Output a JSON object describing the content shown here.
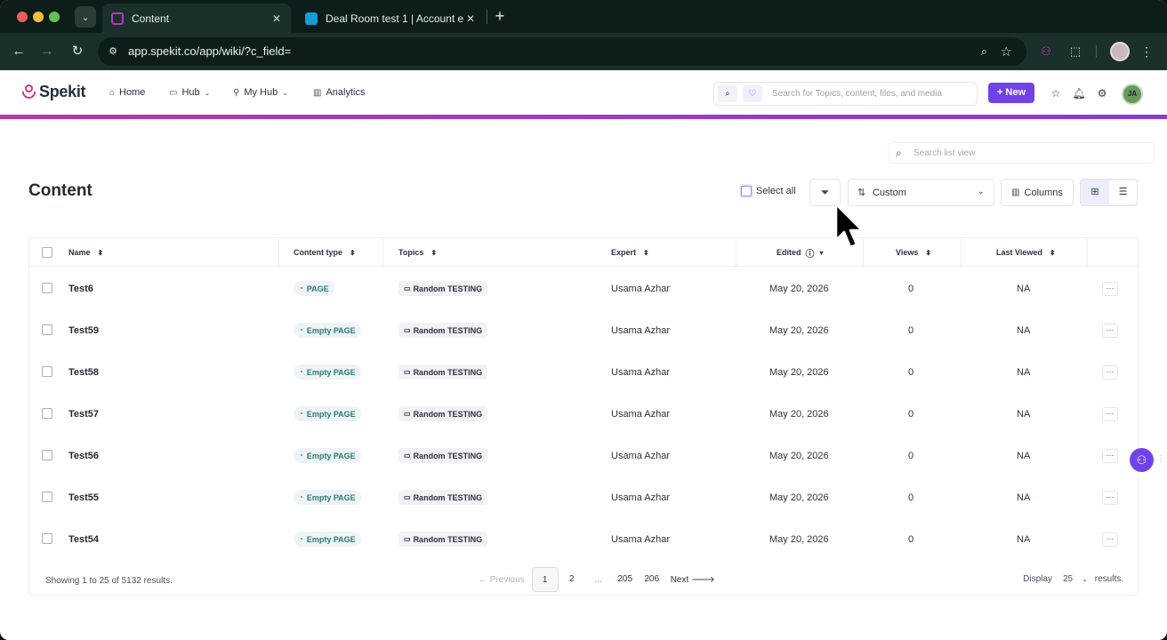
{
  "browser": {
    "tabs": [
      {
        "title": "Content",
        "active": true
      },
      {
        "title": "Deal Room test 1 | Account e",
        "active": false
      }
    ],
    "url": "app.spekit.co/app/wiki/?c_field=",
    "icons": {
      "close": "✕",
      "new_tab": "+",
      "back": "←",
      "forward": "→",
      "reload": "↻",
      "zoom": "⌕",
      "star": "☆",
      "tab_search": "⌄",
      "tune": "⚙",
      "puzzle": "⬚",
      "menu": "⋮",
      "spekit_ext": "⚇"
    }
  },
  "header": {
    "logo": "Spekit",
    "nav": [
      {
        "label": "Home",
        "icon": "⌂"
      },
      {
        "label": "Hub",
        "icon": "▭",
        "caret": "⌄"
      },
      {
        "label": "My Hub",
        "icon": "⚲",
        "caret": "⌄"
      },
      {
        "label": "Analytics",
        "icon": "▥"
      }
    ],
    "search_placeholder": "Search for Topics, content, files, and media",
    "search_icon": "⌕",
    "ai_icon": "♡",
    "new_button": "+ New",
    "star_icon": "☆",
    "bell_icon": "🔔︎",
    "gear_icon": "⚙",
    "avatar_initials": "JA",
    "brand_color": "#7142e8"
  },
  "toolbar": {
    "list_search_placeholder": "Search list view",
    "search_icon": "⌕",
    "page_title": "Content",
    "select_all_label": "Select all",
    "filter_icon": "⏷",
    "sort_icon": "⇅",
    "sort_value": "Custom",
    "caret": "⌄",
    "columns_label": "Columns",
    "columns_icon": "▥",
    "grid_icon": "⊞",
    "list_icon": "☰"
  },
  "table": {
    "columns": [
      {
        "label": "Name",
        "sort": "⬍"
      },
      {
        "label": "Content type",
        "sort": "⬍"
      },
      {
        "label": "Topics",
        "sort": "⬍"
      },
      {
        "label": "Expert",
        "sort": "⬍"
      },
      {
        "label": "Edited",
        "info": "ⓘ",
        "sort": "▾"
      },
      {
        "label": "Views",
        "sort": "⬍"
      },
      {
        "label": "Last Viewed",
        "sort": "⬍"
      }
    ],
    "type_icon": "◔",
    "topic_icon": "▭",
    "more_icon": "···",
    "rows": [
      {
        "name": "Test6",
        "type": "PAGE",
        "topic": "Random TESTING",
        "expert": "Usama Azhar",
        "edited": "May 20, 2026",
        "views": "0",
        "last_viewed": "NA"
      },
      {
        "name": "Test59",
        "type": "Empty PAGE",
        "topic": "Random TESTING",
        "expert": "Usama Azhar",
        "edited": "May 20, 2026",
        "views": "0",
        "last_viewed": "NA"
      },
      {
        "name": "Test58",
        "type": "Empty PAGE",
        "topic": "Random TESTING",
        "expert": "Usama Azhar",
        "edited": "May 20, 2026",
        "views": "0",
        "last_viewed": "NA"
      },
      {
        "name": "Test57",
        "type": "Empty PAGE",
        "topic": "Random TESTING",
        "expert": "Usama Azhar",
        "edited": "May 20, 2026",
        "views": "0",
        "last_viewed": "NA"
      },
      {
        "name": "Test56",
        "type": "Empty PAGE",
        "topic": "Random TESTING",
        "expert": "Usama Azhar",
        "edited": "May 20, 2026",
        "views": "0",
        "last_viewed": "NA"
      },
      {
        "name": "Test55",
        "type": "Empty PAGE",
        "topic": "Random TESTING",
        "expert": "Usama Azhar",
        "edited": "May 20, 2026",
        "views": "0",
        "last_viewed": "NA"
      },
      {
        "name": "Test54",
        "type": "Empty PAGE",
        "topic": "Random TESTING",
        "expert": "Usama Azhar",
        "edited": "May 20, 2026",
        "views": "0",
        "last_viewed": "NA"
      }
    ]
  },
  "footer": {
    "results_text": "Showing 1 to 25 of 5132 results.",
    "prev_label": "← Previous",
    "pages": [
      "1",
      "2",
      "...",
      "205",
      "206"
    ],
    "next_label": "Next 🡒",
    "display_label": "Display",
    "display_value": "25",
    "display_caret": "⌄",
    "results_label": "results."
  },
  "floating": {
    "spekit_icon": "⚇",
    "drag_icon": "⋮⋮"
  }
}
